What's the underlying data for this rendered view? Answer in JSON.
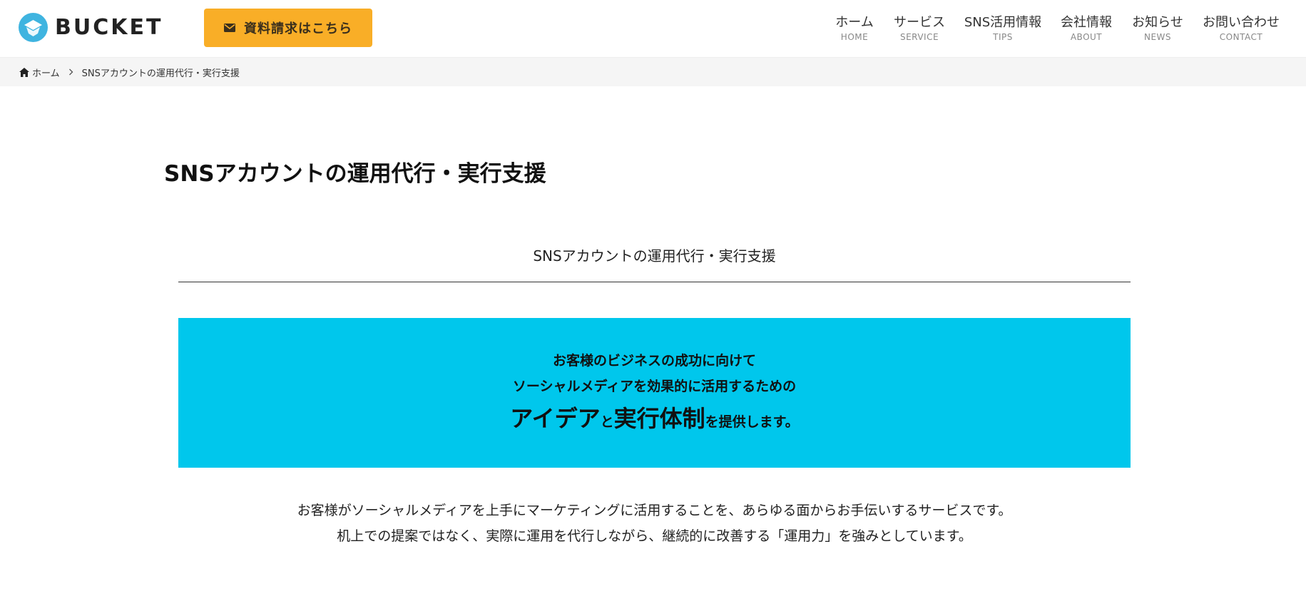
{
  "brand": {
    "name": "BUCKET",
    "accent": "#00c7ec",
    "cta_color": "#f9ae27"
  },
  "header": {
    "cta_label": "資料請求はこちら",
    "nav": [
      {
        "jp": "ホーム",
        "en": "HOME"
      },
      {
        "jp": "サービス",
        "en": "SERVICE"
      },
      {
        "jp": "SNS活用情報",
        "en": "TIPS"
      },
      {
        "jp": "会社情報",
        "en": "ABOUT"
      },
      {
        "jp": "お知らせ",
        "en": "NEWS"
      },
      {
        "jp": "お問い合わせ",
        "en": "CONTACT"
      }
    ]
  },
  "breadcrumb": {
    "home": "ホーム",
    "current": "SNSアカウントの運用代行・実行支援"
  },
  "main": {
    "page_title": "SNSアカウントの運用代行・実行支援",
    "section_title": "SNSアカウントの運用代行・実行支援",
    "banner": {
      "line1": "お客様のビジネスの成功に向けて",
      "line2": "ソーシャルメディアを効果的に活用するための",
      "line3_a": "アイデア",
      "line3_b": "と",
      "line3_c": "実行体制",
      "line3_d": "を提供します。"
    },
    "body_line1": "お客様がソーシャルメディアを上手にマーケティングに活用することを、あらゆる面からお手伝いするサービスです。",
    "body_line2": "机上での提案ではなく、実際に運用を代行しながら、継続的に改善する「運用力」を強みとしています。"
  }
}
